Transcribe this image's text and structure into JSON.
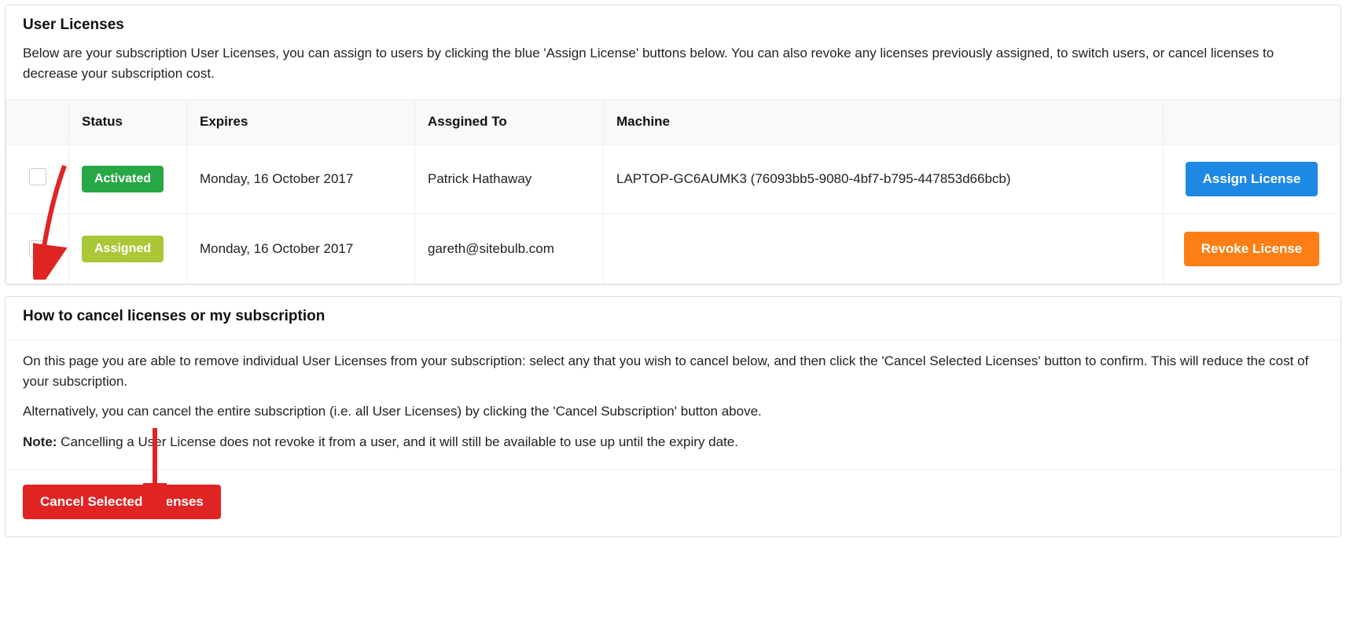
{
  "panel1": {
    "title": "User Licenses",
    "description": "Below are your subscription User Licenses, you can assign to users by clicking the blue 'Assign License' buttons below. You can also revoke any licenses previously assigned, to switch users, or cancel licenses to decrease your subscription cost."
  },
  "table": {
    "headers": {
      "status": "Status",
      "expires": "Expires",
      "assigned_to": "Assgined To",
      "machine": "Machine"
    },
    "rows": [
      {
        "checked": false,
        "status_label": "Activated",
        "status_class": "activated",
        "expires": "Monday, 16 October 2017",
        "assigned_to": "Patrick Hathaway",
        "machine": "LAPTOP-GC6AUMK3 (76093bb5-9080-4bf7-b795-447853d66bcb)",
        "action_label": "Assign License",
        "action_style": "blue"
      },
      {
        "checked": true,
        "status_label": "Assigned",
        "status_class": "assigned",
        "expires": "Monday, 16 October 2017",
        "assigned_to": "gareth@sitebulb.com",
        "machine": "",
        "action_label": "Revoke License",
        "action_style": "orange"
      }
    ]
  },
  "panel2": {
    "title": "How to cancel licenses or my subscription",
    "para1": "On this page you are able to remove individual User Licenses from your subscription: select any that you wish to cancel below, and then click the 'Cancel Selected Licenses' button to confirm. This will reduce the cost of your subscription.",
    "para2": "Alternatively, you can cancel the entire subscription (i.e. all User Licenses) by clicking the 'Cancel Subscription' button above.",
    "note_label": "Note:",
    "note_text": " Cancelling a User License does not revoke it from a user, and it will still be available to use up until the expiry date.",
    "cancel_button": "Cancel Selected Licenses"
  }
}
